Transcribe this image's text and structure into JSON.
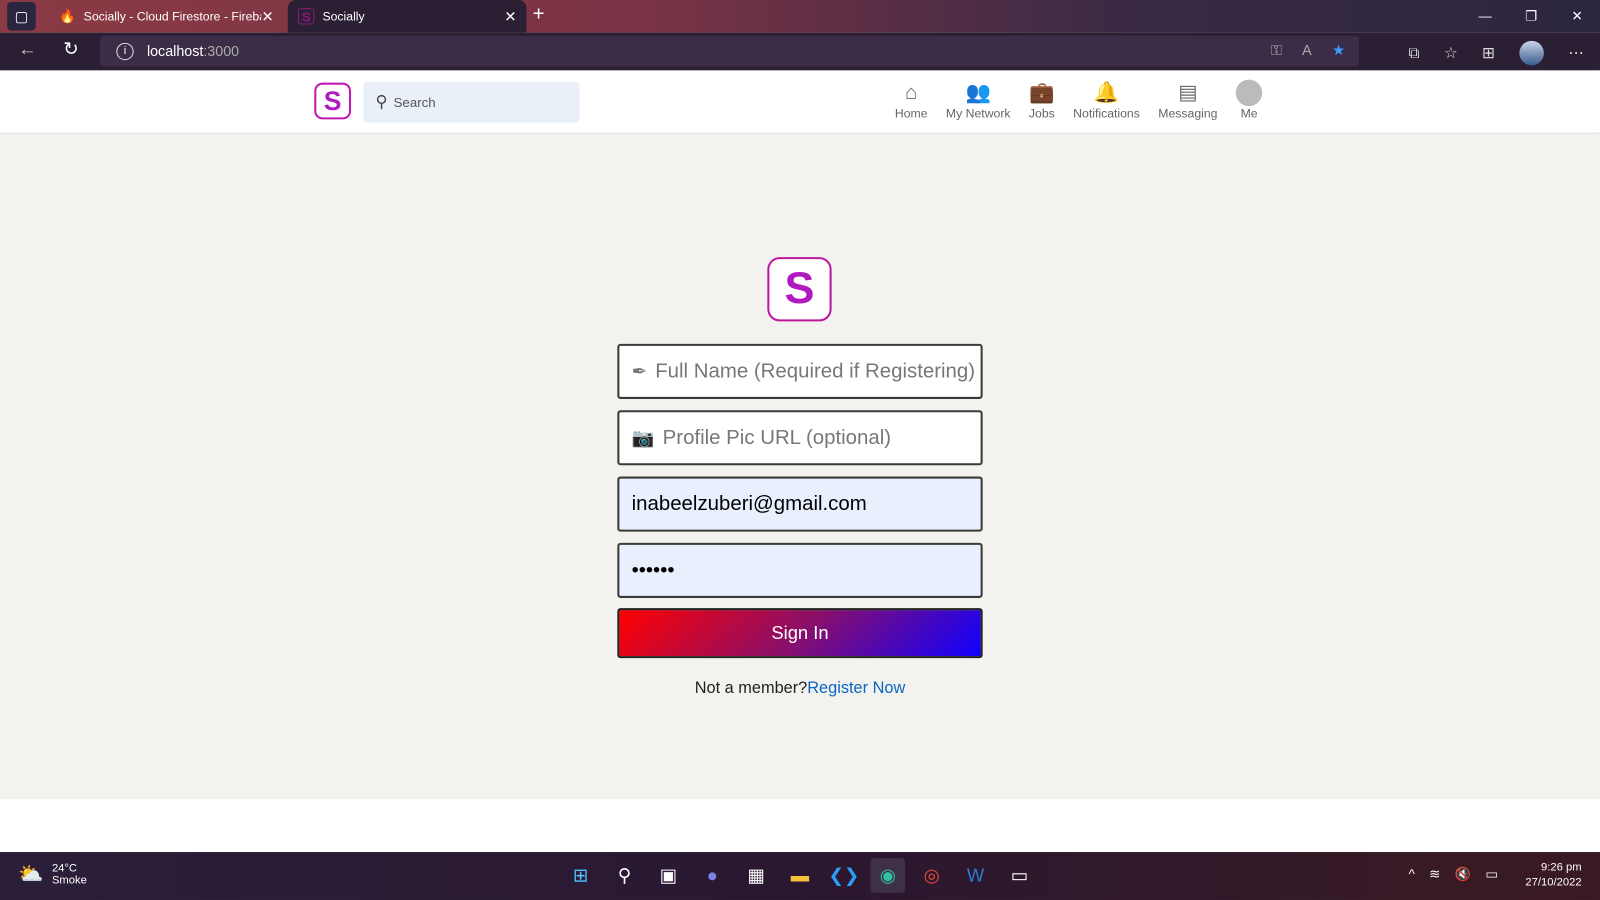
{
  "browser": {
    "tabs": [
      {
        "title": "Socially - Cloud Firestore - Firebase",
        "icon": "firebase-icon"
      },
      {
        "title": "Socially",
        "icon": "socially-icon"
      }
    ],
    "url_host": "localhost",
    "url_port": ":3000"
  },
  "header": {
    "logo": "S",
    "search_placeholder": "Search",
    "nav": [
      {
        "label": "Home",
        "icon": "home-icon"
      },
      {
        "label": "My Network",
        "icon": "network-icon"
      },
      {
        "label": "Jobs",
        "icon": "briefcase-icon"
      },
      {
        "label": "Notifications",
        "icon": "bell-icon"
      },
      {
        "label": "Messaging",
        "icon": "message-icon"
      },
      {
        "label": "Me",
        "icon": "avatar-icon"
      }
    ]
  },
  "form": {
    "logo": "S",
    "full_name_placeholder": "Full Name (Required if Registering)",
    "profile_pic_placeholder": "Profile Pic URL (optional)",
    "email_value": "inabeelzuberi@gmail.com",
    "password_value": "••••••",
    "signin_label": "Sign In",
    "not_member": "Not a member?",
    "register_link": "Register Now"
  },
  "colors": {
    "accent": "#c21ab0",
    "link": "#0a66c2"
  },
  "taskbar": {
    "temp": "24°C",
    "weather": "Smoke",
    "time": "9:26 pm",
    "date": "27/10/2022"
  }
}
